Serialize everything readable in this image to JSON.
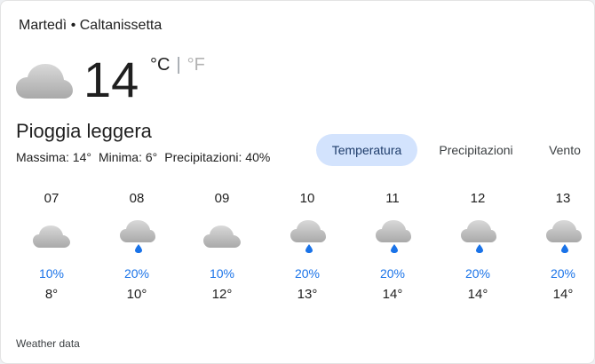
{
  "header": {
    "location": "Martedì • Caltanissetta",
    "temperature": "14",
    "unit_c": "°C",
    "unit_separator": "|",
    "unit_f": "°F",
    "condition": "Pioggia leggera",
    "condition_icon": "cloud-icon",
    "max": "Massima: 14°",
    "min": "Minima: 6°",
    "precip": "Precipitazioni: 40%"
  },
  "tabs": [
    {
      "label": "Temperatura",
      "active": true
    },
    {
      "label": "Precipitazioni",
      "active": false
    },
    {
      "label": "Vento",
      "active": false
    }
  ],
  "hourly": [
    {
      "time": "07",
      "icon": "cloud-icon",
      "precip": "10%",
      "temp": "8°"
    },
    {
      "time": "08",
      "icon": "cloud-rain-icon",
      "precip": "20%",
      "temp": "10°"
    },
    {
      "time": "09",
      "icon": "cloud-icon",
      "precip": "10%",
      "temp": "12°"
    },
    {
      "time": "10",
      "icon": "cloud-rain-icon",
      "precip": "20%",
      "temp": "13°"
    },
    {
      "time": "11",
      "icon": "cloud-rain-icon",
      "precip": "20%",
      "temp": "14°"
    },
    {
      "time": "12",
      "icon": "cloud-rain-icon",
      "precip": "20%",
      "temp": "14°"
    },
    {
      "time": "13",
      "icon": "cloud-rain-icon",
      "precip": "20%",
      "temp": "14°"
    }
  ],
  "footer": {
    "source": "Weather data"
  },
  "colors": {
    "accent": "#1a73e8",
    "active_tab": "#d3e3fd"
  }
}
